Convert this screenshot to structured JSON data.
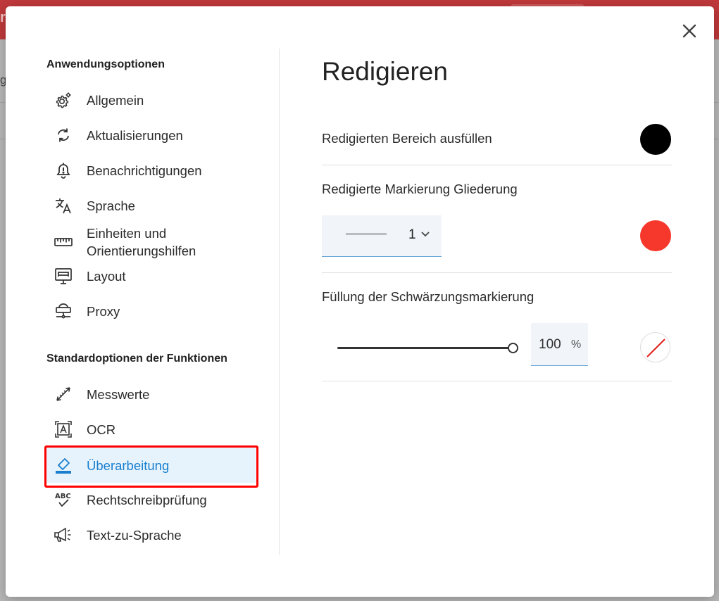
{
  "background": {
    "letter": "g",
    "corner_letter": "r"
  },
  "dialog": {
    "close_icon": "close-icon",
    "sidebar": {
      "section1_title": "Anwendungsoptionen",
      "section1_items": [
        {
          "label": "Allgemein",
          "icon": "gear-icon"
        },
        {
          "label": "Aktualisierungen",
          "icon": "refresh-icon"
        },
        {
          "label": "Benachrichtigungen",
          "icon": "bell-icon"
        },
        {
          "label": "Sprache",
          "icon": "translate-icon"
        },
        {
          "label": "Einheiten und Orientierungshilfen",
          "icon": "ruler-icon"
        },
        {
          "label": "Layout",
          "icon": "layout-icon"
        },
        {
          "label": "Proxy",
          "icon": "proxy-icon"
        }
      ],
      "section2_title": "Standardoptionen der Funktionen",
      "section2_items": [
        {
          "label": "Messwerte",
          "icon": "measure-icon"
        },
        {
          "label": "OCR",
          "icon": "ocr-icon"
        },
        {
          "label": "Überarbeitung",
          "icon": "eraser-icon",
          "active": true
        },
        {
          "label": "Rechtschreibprüfung",
          "icon": "spellcheck-icon"
        },
        {
          "label": "Text-zu-Sprache",
          "icon": "megaphone-icon"
        }
      ]
    },
    "panel": {
      "title": "Redigieren",
      "fill_label": "Redigierten Bereich ausfüllen",
      "fill_color": "#000000",
      "outline_label": "Redigierte Markierung Gliederung",
      "outline_width": "1",
      "outline_color": "#f6372b",
      "marker_fill_label": "Füllung der Schwärzungsmarkierung",
      "marker_fill_value": "100",
      "marker_fill_unit": "%",
      "marker_fill_color": "none"
    }
  },
  "colors": {
    "accent": "#1a7fce",
    "highlight_outline": "#ff0000"
  }
}
